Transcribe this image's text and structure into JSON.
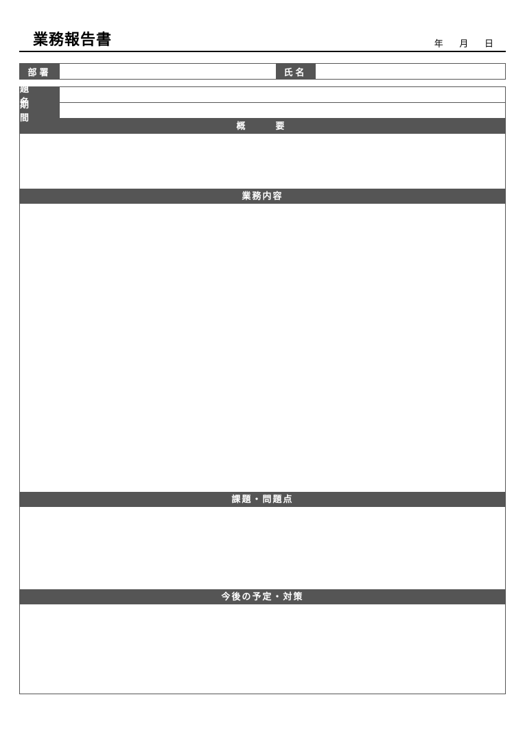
{
  "header": {
    "title": "業務報告書",
    "date_labels": {
      "year": "年",
      "month": "月",
      "day": "日"
    }
  },
  "fields": {
    "department_label": "部署",
    "name_label": "氏名",
    "subject_label": "題　名",
    "period_label": "期　間"
  },
  "sections": {
    "overview": "概　　要",
    "work_content": "業務内容",
    "issues": "課題・問題点",
    "plan": "今後の予定・対策"
  },
  "values": {
    "department": "",
    "name": "",
    "subject": "",
    "period": "",
    "overview": "",
    "work_content": "",
    "issues": "",
    "plan": ""
  }
}
